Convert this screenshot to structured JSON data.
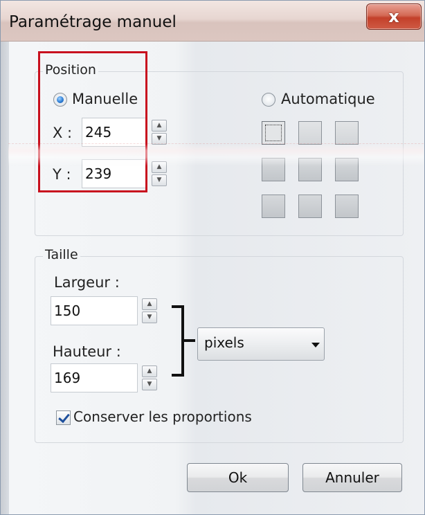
{
  "window": {
    "title": "Paramétrage manuel",
    "close_label": "x"
  },
  "position": {
    "group_label": "Position",
    "manual_label": "Manuelle",
    "auto_label": "Automatique",
    "mode": "manual",
    "x_label": "X :",
    "x_value": "245",
    "y_label": "Y :",
    "y_value": "239",
    "anchor_grid": {
      "rows": 3,
      "cols": 3,
      "selected": "top-left"
    }
  },
  "size": {
    "group_label": "Taille",
    "width_label": "Largeur :",
    "width_value": "150",
    "height_label": "Hauteur :",
    "height_value": "169",
    "unit_value": "pixels",
    "keep_ratio_label": "Conserver les proportions",
    "keep_ratio_checked": true
  },
  "buttons": {
    "ok": "Ok",
    "cancel": "Annuler"
  },
  "colors": {
    "highlight": "#c8101e",
    "radio_selected": "#2f7fd6",
    "close_button": "#c3402a"
  }
}
